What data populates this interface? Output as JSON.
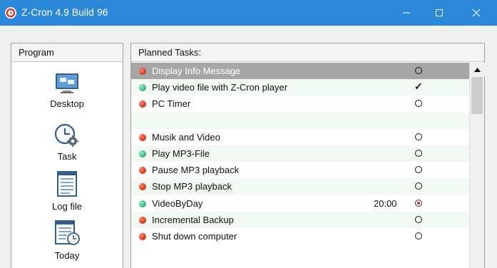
{
  "window": {
    "title": "Z-Cron 4.9 Build 96",
    "controls": [
      "minimize",
      "maximize",
      "close"
    ]
  },
  "sidebar": {
    "header": "Program",
    "items": [
      {
        "label": "Desktop",
        "icon": "desktop-icon"
      },
      {
        "label": "Task",
        "icon": "task-clock-icon"
      },
      {
        "label": "Log file",
        "icon": "log-file-icon"
      },
      {
        "label": "Today",
        "icon": "today-calendar-icon"
      }
    ]
  },
  "tasks": {
    "header": "Planned Tasks:",
    "rows": [
      {
        "name": "Display Info Message",
        "dot": "red",
        "time": "",
        "status": "circle",
        "selected": true
      },
      {
        "name": "Play video file with Z-Cron player",
        "dot": "green",
        "time": "",
        "status": "check"
      },
      {
        "name": "PC Timer",
        "dot": "red",
        "time": "",
        "status": "circle"
      },
      {
        "name": "",
        "dot": "",
        "time": "",
        "status": ""
      },
      {
        "name": "Musik and Video",
        "dot": "red",
        "time": "",
        "status": "circle"
      },
      {
        "name": "Play MP3-File",
        "dot": "green",
        "time": "",
        "status": "circle"
      },
      {
        "name": "Pause MP3 playback",
        "dot": "red",
        "time": "",
        "status": "circle"
      },
      {
        "name": "Stop MP3 playback",
        "dot": "red",
        "time": "",
        "status": "circle"
      },
      {
        "name": "VideoByDay",
        "dot": "green",
        "time": "20:00",
        "status": "radio-active"
      },
      {
        "name": "Incremental Backup",
        "dot": "red",
        "time": "",
        "status": "circle"
      },
      {
        "name": "Shut down computer",
        "dot": "red",
        "time": "",
        "status": "circle"
      }
    ]
  },
  "colors": {
    "titlebar": "#2b88d8",
    "selected_row": "#a6a6a6",
    "status_red": "#d83a1e",
    "status_green": "#3cb886"
  }
}
